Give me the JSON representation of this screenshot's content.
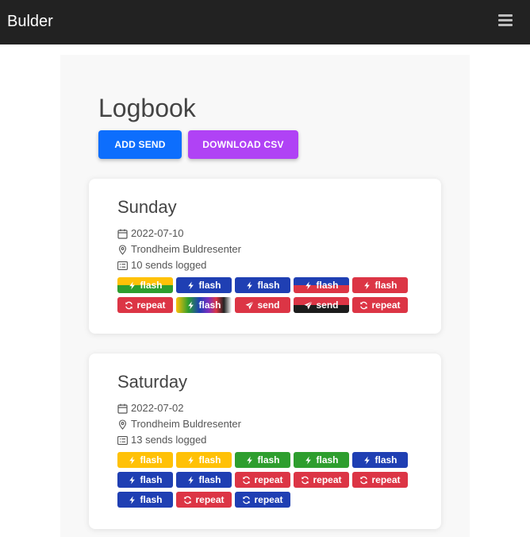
{
  "app": {
    "title": "Bulder"
  },
  "nav": {
    "menu_icon": "hamburger-icon"
  },
  "page": {
    "title": "Logbook"
  },
  "actions": {
    "add_send": "ADD SEND",
    "download_csv": "DOWNLOAD CSV"
  },
  "colors": {
    "yellow": "#ffc107",
    "green": "#2e9e2e",
    "blue": "#1f3fb3",
    "red": "#dc3545",
    "black": "#1c1c1c",
    "primary": "#0d6efd",
    "purple": "#b042f5"
  },
  "sessions": [
    {
      "day": "Sunday",
      "date": "2022-07-10",
      "location": "Trondheim Buldresenter",
      "sends": "10 sends logged",
      "tags": [
        {
          "type": "flash",
          "label": "flash",
          "color": "yellow-green"
        },
        {
          "type": "flash",
          "label": "flash",
          "color": "blue"
        },
        {
          "type": "flash",
          "label": "flash",
          "color": "blue"
        },
        {
          "type": "flash",
          "label": "flash",
          "color": "blue-red"
        },
        {
          "type": "flash",
          "label": "flash",
          "color": "red"
        },
        {
          "type": "repeat",
          "label": "repeat",
          "color": "red"
        },
        {
          "type": "flash",
          "label": "flash",
          "color": "rainbow"
        },
        {
          "type": "send",
          "label": "send",
          "color": "red"
        },
        {
          "type": "send",
          "label": "send",
          "color": "red-black"
        },
        {
          "type": "repeat",
          "label": "repeat",
          "color": "red"
        }
      ]
    },
    {
      "day": "Saturday",
      "date": "2022-07-02",
      "location": "Trondheim Buldresenter",
      "sends": "13 sends logged",
      "tags": [
        {
          "type": "flash",
          "label": "flash",
          "color": "yellow"
        },
        {
          "type": "flash",
          "label": "flash",
          "color": "yellow"
        },
        {
          "type": "flash",
          "label": "flash",
          "color": "green"
        },
        {
          "type": "flash",
          "label": "flash",
          "color": "green"
        },
        {
          "type": "flash",
          "label": "flash",
          "color": "blue"
        },
        {
          "type": "flash",
          "label": "flash",
          "color": "blue"
        },
        {
          "type": "flash",
          "label": "flash",
          "color": "blue"
        },
        {
          "type": "repeat",
          "label": "repeat",
          "color": "red"
        },
        {
          "type": "repeat",
          "label": "repeat",
          "color": "red"
        },
        {
          "type": "repeat",
          "label": "repeat",
          "color": "red"
        },
        {
          "type": "flash",
          "label": "flash",
          "color": "blue"
        },
        {
          "type": "repeat",
          "label": "repeat",
          "color": "red"
        },
        {
          "type": "repeat",
          "label": "repeat",
          "color": "blue"
        }
      ]
    }
  ]
}
